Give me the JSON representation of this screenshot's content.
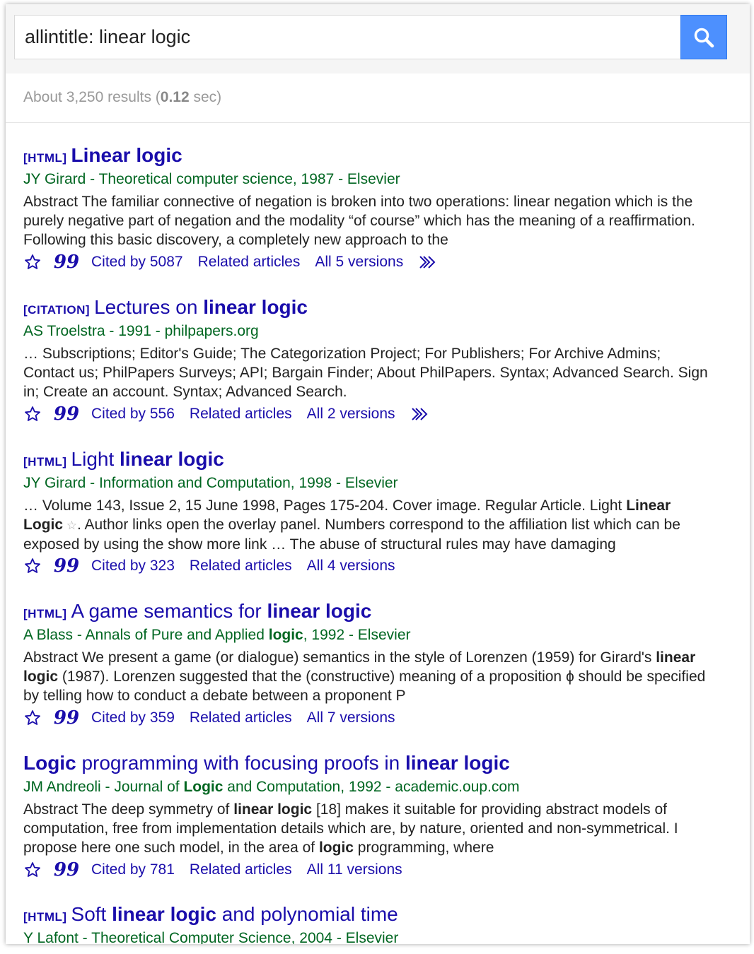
{
  "search": {
    "query": "allintitle: linear logic"
  },
  "stats": {
    "prefix": "About 3,250 results (",
    "time": "0.12",
    "suffix": " sec)"
  },
  "colors": {
    "link": "#1a0dab",
    "source": "#006621",
    "search_button": "#4d90fe"
  },
  "results": [
    {
      "type": "[HTML]",
      "title_parts": [
        {
          "t": "Linear logic",
          "b": true
        }
      ],
      "source_parts": [
        {
          "t": "JY Girard - Theoretical computer science, 1987 - Elsevier",
          "b": false
        }
      ],
      "snippet_parts": [
        {
          "t": "Abstract The familiar connective of negation is broken into two operations: linear negation which is the purely negative part of negation and the modality “of course” which has the meaning of a reaffirmation. Following this basic discovery, a completely new approach to the",
          "b": false
        }
      ],
      "cited": "Cited by 5087",
      "related": "Related articles",
      "versions": "All 5 versions",
      "has_more": true
    },
    {
      "type": "[CITATION]",
      "title_parts": [
        {
          "t": "Lectures on ",
          "b": false
        },
        {
          "t": "linear logic",
          "b": true
        }
      ],
      "source_parts": [
        {
          "t": "AS Troelstra - 1991 - philpapers.org",
          "b": false
        }
      ],
      "snippet_parts": [
        {
          "t": "… Subscriptions; Editor's Guide; The Categorization Project; For Publishers; For Archive Admins; Contact us; PhilPapers Surveys; API; Bargain Finder; About PhilPapers. Syntax; Advanced Search. Sign in; Create an account. Syntax; Advanced Search.",
          "b": false
        }
      ],
      "cited": "Cited by 556",
      "related": "Related articles",
      "versions": "All 2 versions",
      "has_more": true
    },
    {
      "type": "[HTML]",
      "title_parts": [
        {
          "t": "Light ",
          "b": false
        },
        {
          "t": "linear logic",
          "b": true
        }
      ],
      "source_parts": [
        {
          "t": "JY Girard - Information and Computation, 1998 - Elsevier",
          "b": false
        }
      ],
      "snippet_parts": [
        {
          "t": "… Volume 143, Issue 2, 15 June 1998, Pages 175-204. Cover image. Regular Article. Light ",
          "b": false
        },
        {
          "t": "Linear Logic",
          "b": true
        },
        {
          "t": " ☆",
          "b": false,
          "star": true
        },
        {
          "t": ". Author links open the overlay panel. Numbers correspond to the affiliation list which can be exposed by using the show more link … The abuse of structural rules may have damaging",
          "b": false
        }
      ],
      "cited": "Cited by 323",
      "related": "Related articles",
      "versions": "All 4 versions",
      "has_more": false
    },
    {
      "type": "[HTML]",
      "title_parts": [
        {
          "t": "A game semantics for ",
          "b": false
        },
        {
          "t": "linear logic",
          "b": true
        }
      ],
      "source_parts": [
        {
          "t": "A Blass - Annals of Pure and Applied ",
          "b": false
        },
        {
          "t": "logic",
          "b": true
        },
        {
          "t": ", 1992 - Elsevier",
          "b": false
        }
      ],
      "snippet_parts": [
        {
          "t": "Abstract We present a game (or dialogue) semantics in the style of Lorenzen (1959) for Girard's ",
          "b": false
        },
        {
          "t": "linear logic",
          "b": true
        },
        {
          "t": " (1987). Lorenzen suggested that the (constructive) meaning of a proposition ϕ should be specified by telling how to conduct a debate between a proponent P",
          "b": false
        }
      ],
      "cited": "Cited by 359",
      "related": "Related articles",
      "versions": "All 7 versions",
      "has_more": false
    },
    {
      "type": "",
      "title_parts": [
        {
          "t": "Logic",
          "b": true
        },
        {
          "t": " programming with focusing proofs in ",
          "b": false
        },
        {
          "t": "linear logic",
          "b": true
        }
      ],
      "source_parts": [
        {
          "t": "JM Andreoli - Journal of ",
          "b": false
        },
        {
          "t": "Logic",
          "b": true
        },
        {
          "t": " and Computation, 1992 - academic.oup.com",
          "b": false
        }
      ],
      "snippet_parts": [
        {
          "t": "Abstract The deep symmetry of ",
          "b": false
        },
        {
          "t": "linear logic",
          "b": true
        },
        {
          "t": " [18] makes it suitable for providing abstract models of computation, free from implementation details which are, by nature, oriented and non-symmetrical. I propose here one such model, in the area of ",
          "b": false
        },
        {
          "t": "logic",
          "b": true
        },
        {
          "t": " programming, where",
          "b": false
        }
      ],
      "cited": "Cited by 781",
      "related": "Related articles",
      "versions": "All 11 versions",
      "has_more": false
    },
    {
      "type": "[HTML]",
      "title_parts": [
        {
          "t": "Soft ",
          "b": false
        },
        {
          "t": "linear logic",
          "b": true
        },
        {
          "t": " and polynomial time",
          "b": false
        }
      ],
      "source_parts": [
        {
          "t": "Y Lafont - Theoretical Computer Science, 2004 - Elsevier",
          "b": false
        }
      ]
    }
  ]
}
